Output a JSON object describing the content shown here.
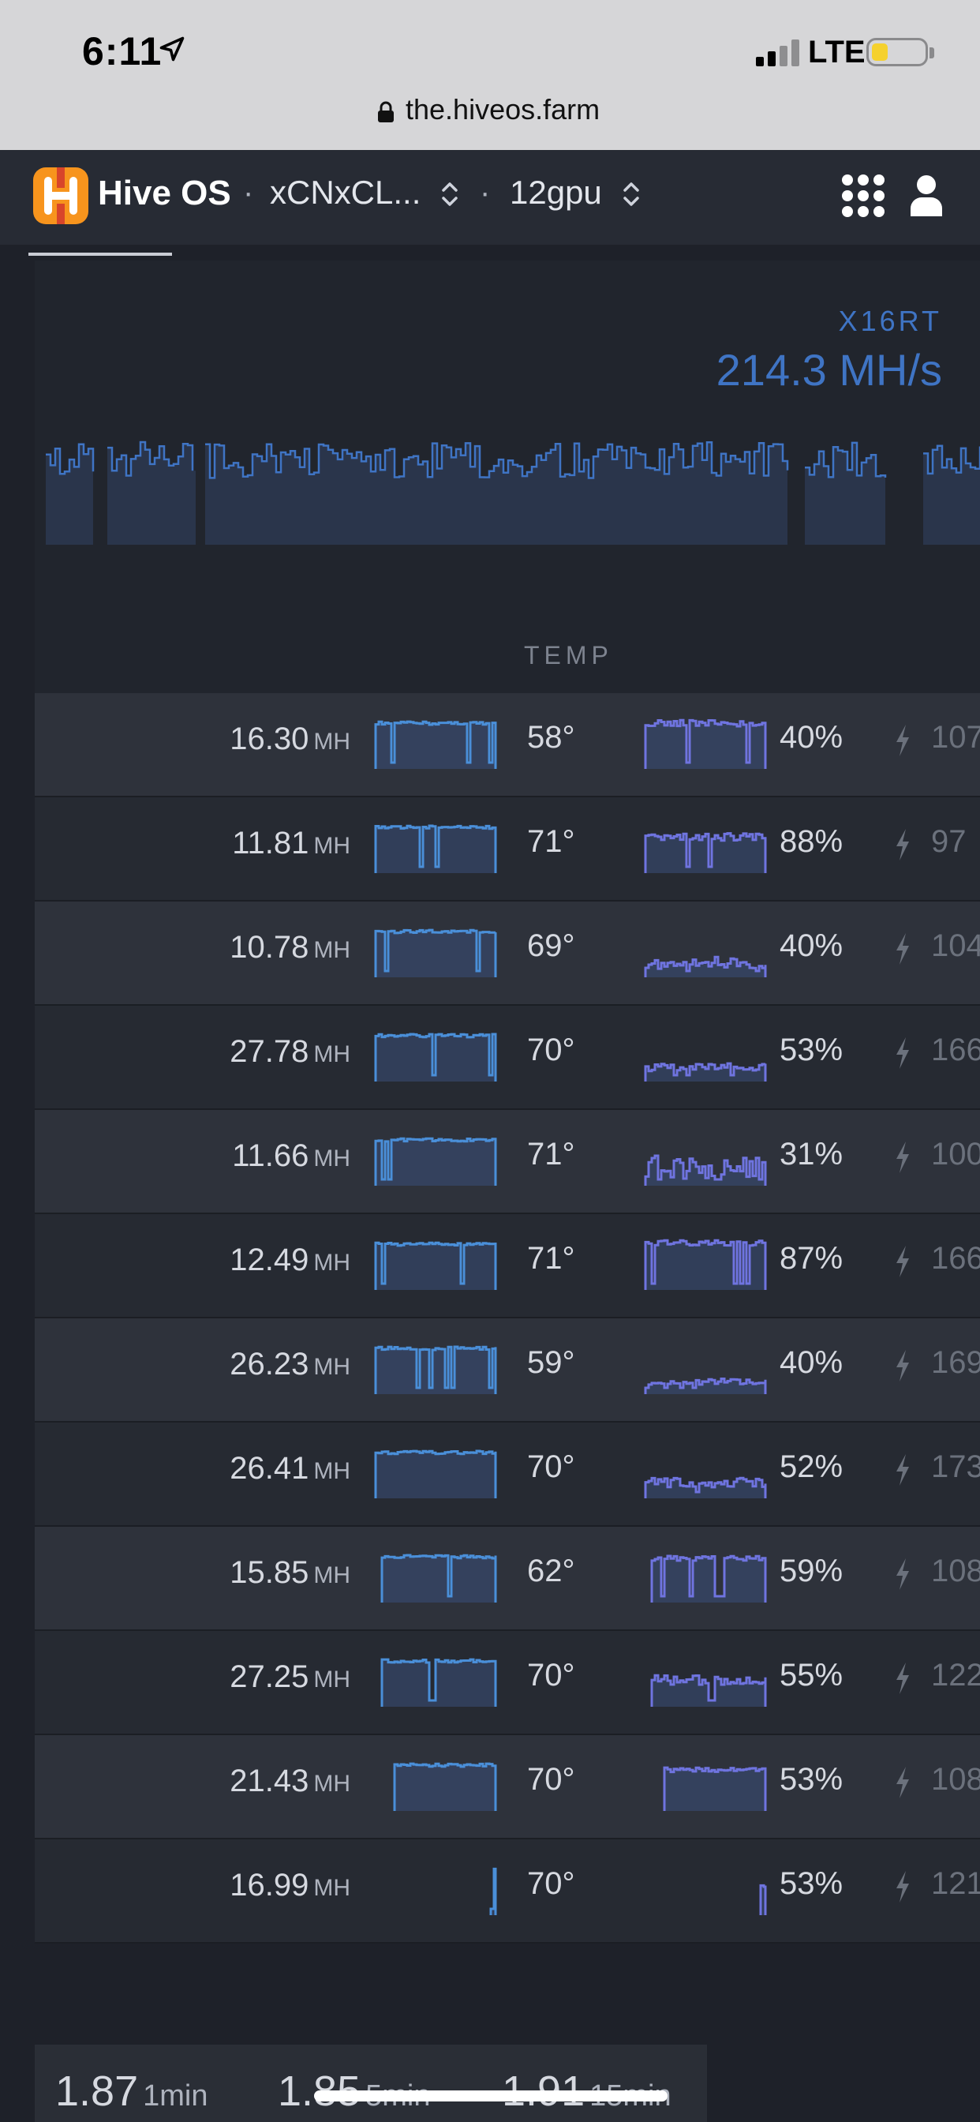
{
  "status_bar": {
    "time": "6:11",
    "network": "LTE"
  },
  "browser": {
    "url": "the.hiveos.farm"
  },
  "header": {
    "brand": "Hive OS",
    "separator": "·",
    "farm_name": "xCNxCL...",
    "worker_name": "12gpu"
  },
  "miner": {
    "name": "X16RT",
    "hashrate": "214.3 MH/s"
  },
  "table": {
    "temp_header": "TEMP",
    "rows": [
      {
        "hash": "16.30",
        "unit": "MH",
        "temp": "58°",
        "fan": "40%",
        "power": "107"
      },
      {
        "hash": "11.81",
        "unit": "MH",
        "temp": "71°",
        "fan": "88%",
        "power": "97"
      },
      {
        "hash": "10.78",
        "unit": "MH",
        "temp": "69°",
        "fan": "40%",
        "power": "104"
      },
      {
        "hash": "27.78",
        "unit": "MH",
        "temp": "70°",
        "fan": "53%",
        "power": "166"
      },
      {
        "hash": "11.66",
        "unit": "MH",
        "temp": "71°",
        "fan": "31%",
        "power": "100"
      },
      {
        "hash": "12.49",
        "unit": "MH",
        "temp": "71°",
        "fan": "87%",
        "power": "166"
      },
      {
        "hash": "26.23",
        "unit": "MH",
        "temp": "59°",
        "fan": "40%",
        "power": "169"
      },
      {
        "hash": "26.41",
        "unit": "MH",
        "temp": "70°",
        "fan": "52%",
        "power": "173"
      },
      {
        "hash": "15.85",
        "unit": "MH",
        "temp": "62°",
        "fan": "59%",
        "power": "108"
      },
      {
        "hash": "27.25",
        "unit": "MH",
        "temp": "70°",
        "fan": "55%",
        "power": "122"
      },
      {
        "hash": "21.43",
        "unit": "MH",
        "temp": "70°",
        "fan": "53%",
        "power": "108"
      },
      {
        "hash": "16.99",
        "unit": "MH",
        "temp": "70°",
        "fan": "53%",
        "power": "121"
      }
    ]
  },
  "load_average": [
    {
      "value": "1.87",
      "unit": "1min"
    },
    {
      "value": "1.85",
      "unit": "5min"
    },
    {
      "value": "1.91",
      "unit": "15min"
    }
  ],
  "colors": {
    "hash_line": "#4a8fd9",
    "fan_line": "#6f74e0",
    "accent": "#3f74c4",
    "logo_orange": "#f7941d"
  }
}
